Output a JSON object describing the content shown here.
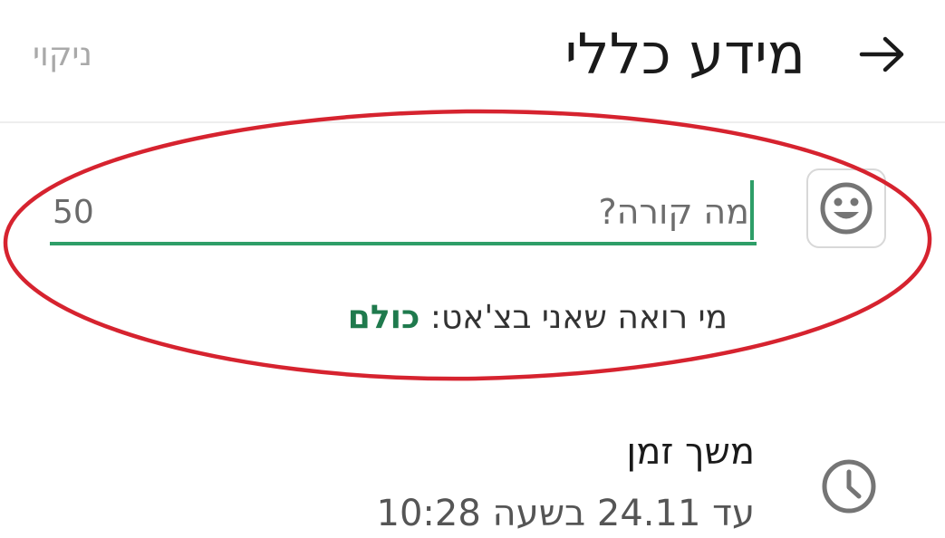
{
  "header": {
    "title": "מידע כללי",
    "clear_label": "ניקוי",
    "back_icon": "arrow-right-icon"
  },
  "status": {
    "placeholder": "מה קורה?",
    "value": "",
    "char_counter": "50",
    "emoji_icon": "smiley-icon",
    "visibility_label": "מי רואה שאני בצ'אט:",
    "visibility_value": "כולם"
  },
  "duration": {
    "icon": "clock-icon",
    "title": "משך זמן",
    "value": "עד 24.11 בשעה 10:28"
  },
  "colors": {
    "accent": "#2e9e68",
    "accent_text": "#1f7a4d",
    "annotation": "#d6232f"
  }
}
